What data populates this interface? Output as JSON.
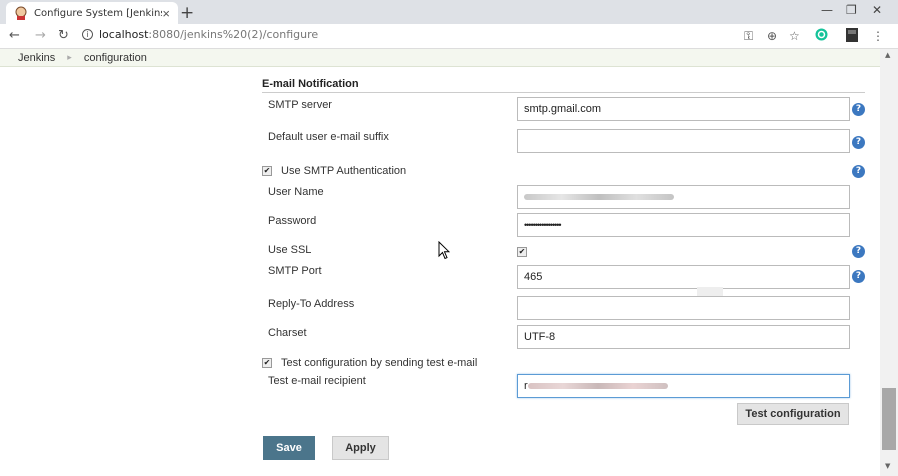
{
  "browser": {
    "tab_title": "Configure System [Jenkins]",
    "tab_close": "×",
    "new_tab": "+",
    "url_host": "localhost",
    "url_rest": ":8080/jenkins%20(2)/configure",
    "icons": [
      "back-arrow-icon",
      "forward-arrow-icon",
      "reload-icon",
      "info-icon",
      "key-icon",
      "zoom-icon",
      "star-icon",
      "grammarly-icon",
      "extension-icon",
      "menu-icon"
    ]
  },
  "breadcrumb": {
    "items": [
      "Jenkins",
      "configuration"
    ]
  },
  "section": {
    "title": "E-mail Notification"
  },
  "form": {
    "smtp_server_label": "SMTP server",
    "smtp_server_value": "smtp.gmail.com",
    "suffix_label": "Default user e-mail suffix",
    "suffix_value": "",
    "use_smtp_auth_label": "Use SMTP Authentication",
    "use_smtp_auth_checked": true,
    "username_label": "User Name",
    "password_label": "Password",
    "password_value": "•••••••••••••••••",
    "use_ssl_label": "Use SSL",
    "use_ssl_checked": true,
    "smtp_port_label": "SMTP Port",
    "smtp_port_value": "465",
    "reply_to_label": "Reply-To Address",
    "reply_to_value": "",
    "charset_label": "Charset",
    "charset_value": "UTF-8",
    "test_config_label": "Test configuration by sending test e-mail",
    "test_config_checked": true,
    "test_recipient_label": "Test e-mail recipient",
    "test_recipient_prefix": "r"
  },
  "buttons": {
    "test_configuration": "Test configuration",
    "save": "Save",
    "apply": "Apply"
  },
  "colors": {
    "save_button": "#4b758b",
    "help_icon": "#3c78c0",
    "focus_border": "#5b9bd5",
    "breadcrumb_bg": "#f4f7ef"
  }
}
